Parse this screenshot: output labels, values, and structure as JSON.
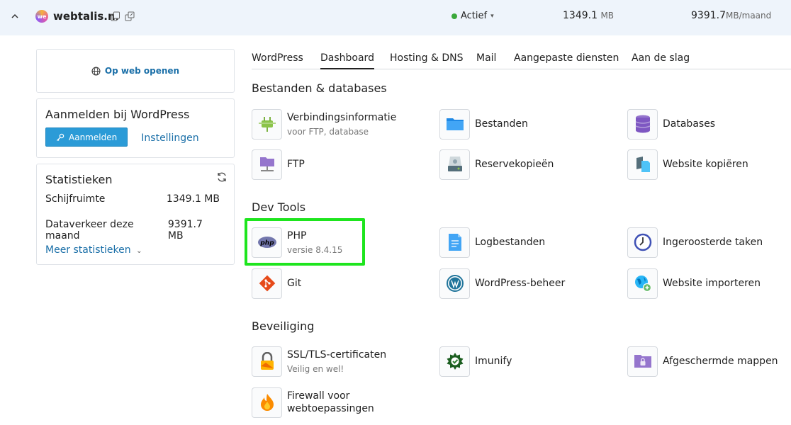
{
  "topbar": {
    "site_name": "webtalis.nl",
    "logo_text": "we",
    "status": "Actief",
    "disk_value": "1349.1",
    "disk_unit": "MB",
    "traffic_value": "9391.7",
    "traffic_unit": "MB/maand"
  },
  "sidebar": {
    "open_web_label": "Op web openen",
    "wp_title": "Aanmelden bij WordPress",
    "login_label": "Aanmelden",
    "settings_label": "Instellingen",
    "stats_title": "Statistieken",
    "disk_label": "Schijfruimte",
    "disk_value": "1349.1 MB",
    "traffic_label": "Dataverkeer deze maand",
    "traffic_value": "9391.7 MB",
    "more_stats_label": "Meer statistieken"
  },
  "tabs": [
    "WordPress",
    "Dashboard",
    "Hosting & DNS",
    "Mail",
    "Aangepaste diensten",
    "Aan de slag"
  ],
  "active_tab": "Dashboard",
  "sections": {
    "files": {
      "title": "Bestanden & databases",
      "items": [
        {
          "name": "Verbindingsinformatie",
          "sub": "voor FTP, database",
          "icon": "plug-icon"
        },
        {
          "name": "Bestanden",
          "icon": "folder-icon"
        },
        {
          "name": "Databases",
          "icon": "database-icon"
        },
        {
          "name": "FTP",
          "icon": "ftp-folder-icon"
        },
        {
          "name": "Reservekopieën",
          "icon": "backup-drive-icon"
        },
        {
          "name": "Website kopiëren",
          "icon": "copy-website-icon"
        }
      ]
    },
    "devtools": {
      "title": "Dev Tools",
      "items": [
        {
          "name": "PHP",
          "sub": "versie 8.4.15",
          "icon": "php-icon"
        },
        {
          "name": "Logbestanden",
          "icon": "log-file-icon"
        },
        {
          "name": "Ingeroosterde taken",
          "icon": "clock-icon"
        },
        {
          "name": "Git",
          "icon": "git-icon"
        },
        {
          "name": "WordPress-beheer",
          "icon": "wordpress-icon"
        },
        {
          "name": "Website importeren",
          "icon": "globe-import-icon"
        }
      ]
    },
    "security": {
      "title": "Beveiliging",
      "items": [
        {
          "name": "SSL/TLS-certificaten",
          "sub": "Veilig en wel!",
          "icon": "lock-icon"
        },
        {
          "name": "Imunify",
          "icon": "imunify-icon"
        },
        {
          "name": "Afgeschermde mappen",
          "icon": "protected-folder-icon"
        },
        {
          "name": "Firewall voor",
          "name2": "webtoepassingen",
          "icon": "flame-icon"
        }
      ]
    }
  },
  "colors": {
    "accent": "#2b9bd7",
    "link": "#1a6fa8",
    "status_active": "#3aa83a",
    "highlight": "#1ee51e",
    "topbar_bg": "#eef4fb"
  }
}
